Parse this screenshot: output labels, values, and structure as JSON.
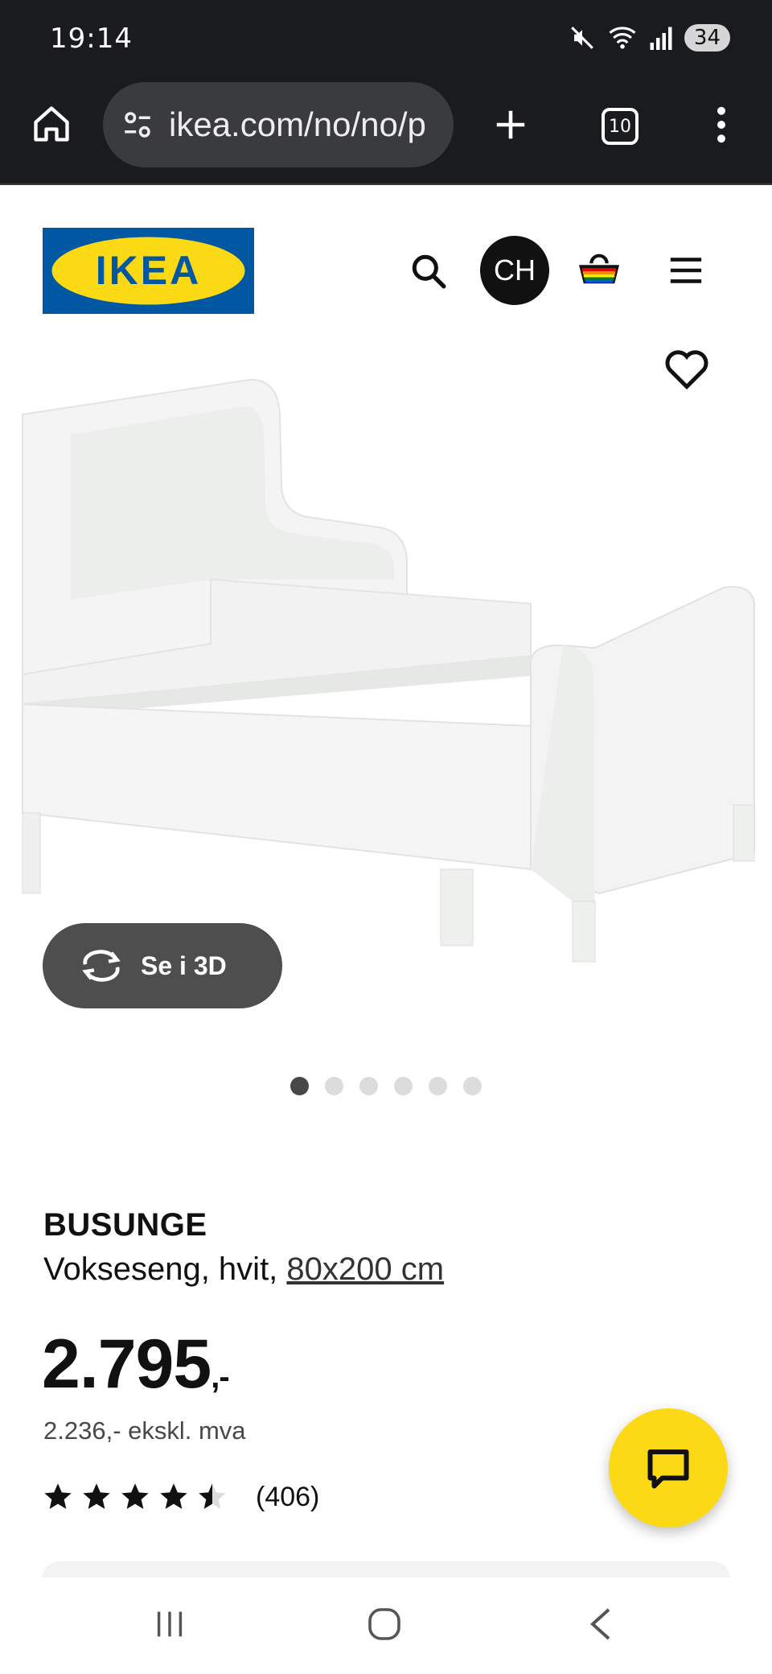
{
  "status_bar": {
    "time": "19:14",
    "battery": "34"
  },
  "browser": {
    "url": "ikea.com/no/no/p",
    "tab_count": "10"
  },
  "header": {
    "logo_text": "IKEA",
    "avatar_initials": "CH"
  },
  "gallery": {
    "view_3d_label": "Se i 3D",
    "image_count": 6,
    "active_index": 0
  },
  "product": {
    "name": "BUSUNGE",
    "description": "Vokseseng, hvit, ",
    "size": "80x200 cm",
    "price": "2.795",
    "price_suffix": ",-",
    "price_ex_vat": "2.236,- ekskl. mva",
    "rating": 4.5,
    "review_count": "(406)"
  },
  "colors": {
    "ikea_blue": "#0058a3",
    "ikea_yellow": "#fbd914",
    "browser_bg": "#1a1b1f"
  },
  "icons": {
    "home": "home-icon",
    "site_settings": "tune-icon",
    "new_tab": "plus-icon",
    "menu": "more-vert-icon",
    "search": "search-icon",
    "cart": "basket-icon",
    "nav_menu": "hamburger-icon",
    "favourite": "heart-icon",
    "rotate_3d": "rotate-icon",
    "chat": "chat-icon"
  }
}
